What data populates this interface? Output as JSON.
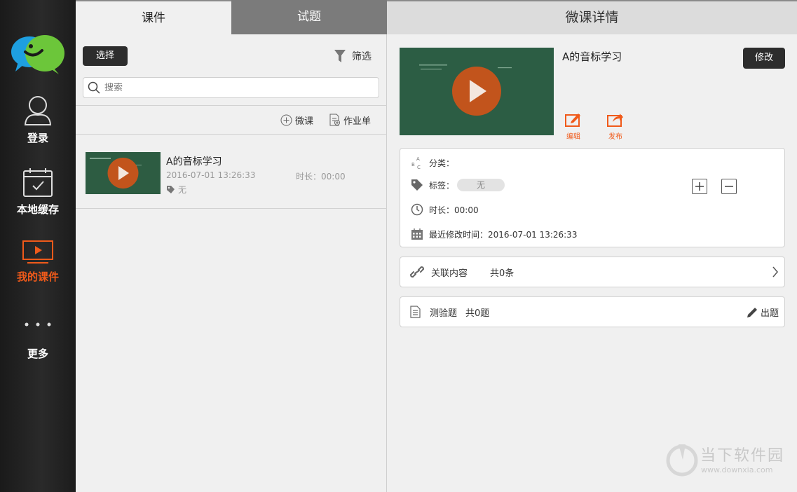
{
  "sidebar": {
    "items": [
      {
        "label": "登录",
        "icon": "user-icon"
      },
      {
        "label": "本地缓存",
        "icon": "calendar-check-icon"
      },
      {
        "label": "我的课件",
        "icon": "play-screen-icon",
        "active": true
      },
      {
        "label": "更多",
        "icon": "more-dots-icon"
      }
    ]
  },
  "tabs": {
    "courseware": "课件",
    "questions": "试题"
  },
  "toolbar": {
    "select_label": "选择",
    "filter_label": "筛选"
  },
  "search": {
    "placeholder": "搜索"
  },
  "actions": {
    "micro_lesson": "微课",
    "worksheet": "作业单"
  },
  "course_list": [
    {
      "title": "A的音标学习",
      "date": "2016-07-01 13:26:33",
      "duration": "时长：00:00",
      "tag": "无"
    }
  ],
  "detail": {
    "header": "微课详情",
    "title": "A的音标学习",
    "modify_label": "修改",
    "edit_label": "编辑",
    "publish_label": "发布",
    "category_label": "分类：",
    "tag_label": "标签：",
    "tag_value": "无",
    "duration": "时长：00:00",
    "modified": "最近修改时间：2016-07-01 13:26:33",
    "related_label": "关联内容",
    "related_count": "共0条",
    "quiz_label": "测验题",
    "quiz_count": "共0题",
    "make_quiz_label": "出题"
  },
  "watermark": {
    "text": "当下软件园",
    "url": "www.downxia.com"
  },
  "colors": {
    "accent": "#f05a1a",
    "sidebar_bg": "#1e1e1e",
    "video_bg": "#2c5d44"
  }
}
